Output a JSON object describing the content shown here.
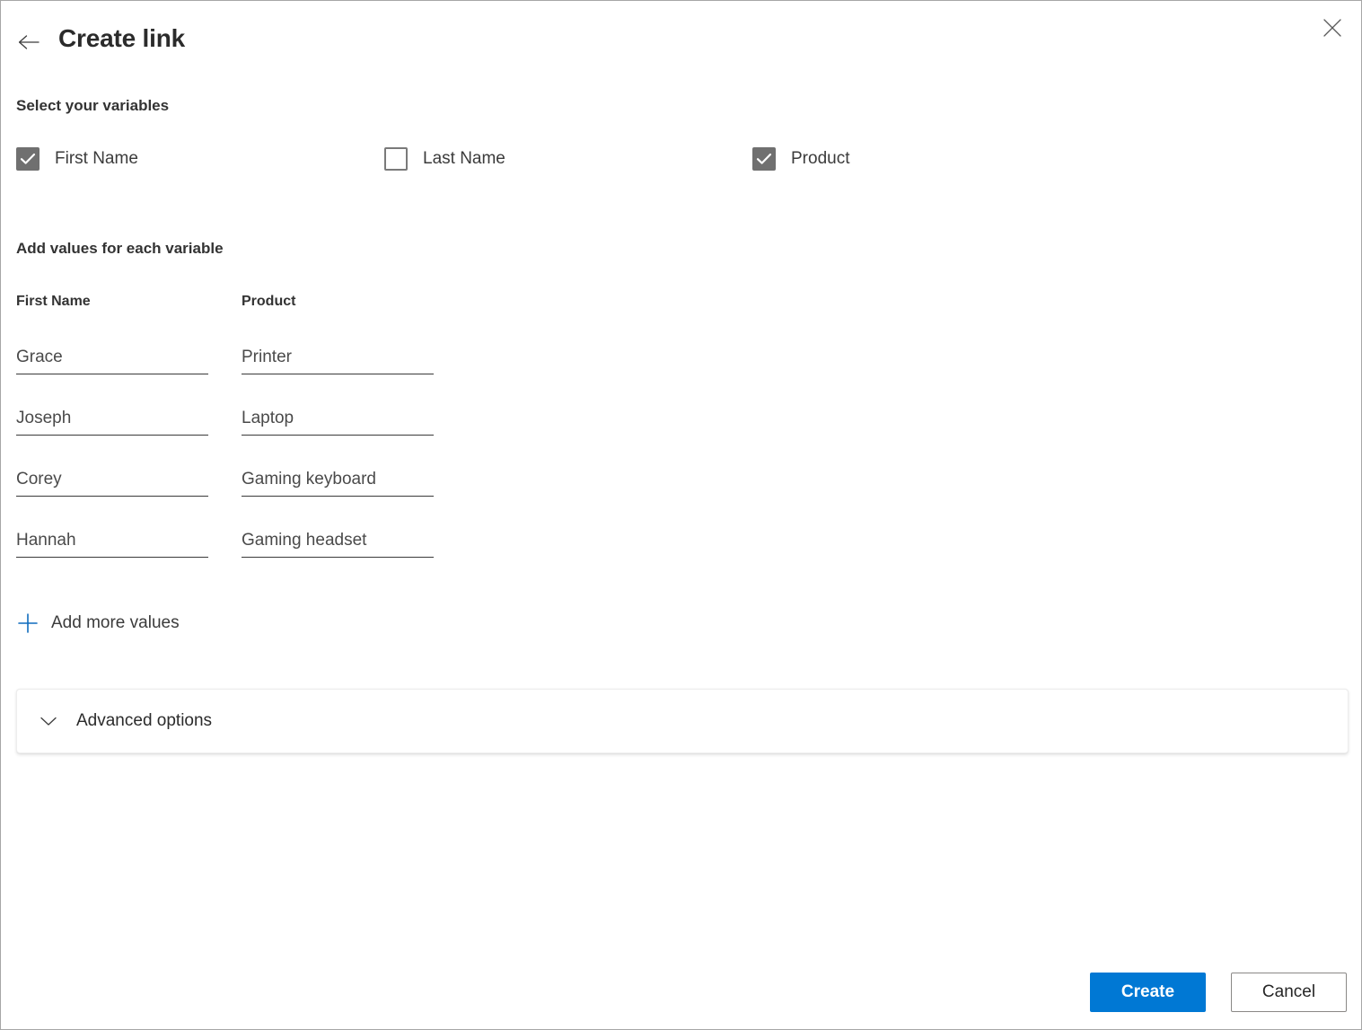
{
  "window": {
    "title": "Create link",
    "back_icon": "arrow-left-icon",
    "close_icon": "close-icon"
  },
  "variables_section": {
    "heading": "Select your variables",
    "items": [
      {
        "label": "First Name",
        "checked": true
      },
      {
        "label": "Last Name",
        "checked": false
      },
      {
        "label": "Product",
        "checked": true
      }
    ]
  },
  "values_section": {
    "heading": "Add values for each variable",
    "columns": [
      {
        "header": "First Name",
        "values": [
          "Grace",
          "Joseph",
          "Corey",
          "Hannah"
        ]
      },
      {
        "header": "Product",
        "values": [
          "Printer",
          "Laptop",
          "Gaming keyboard",
          "Gaming headset"
        ]
      }
    ],
    "add_more_label": "Add more values",
    "add_more_icon": "plus-icon"
  },
  "advanced_options": {
    "label": "Advanced options",
    "icon": "chevron-down-icon",
    "expanded": false
  },
  "footer": {
    "create_label": "Create",
    "cancel_label": "Cancel"
  },
  "colors": {
    "accent": "#0078d4",
    "checkbox_checked": "#707070",
    "text_primary": "#2b2b2b",
    "text_secondary": "#4a4a4a",
    "border": "#a6a6a6"
  }
}
